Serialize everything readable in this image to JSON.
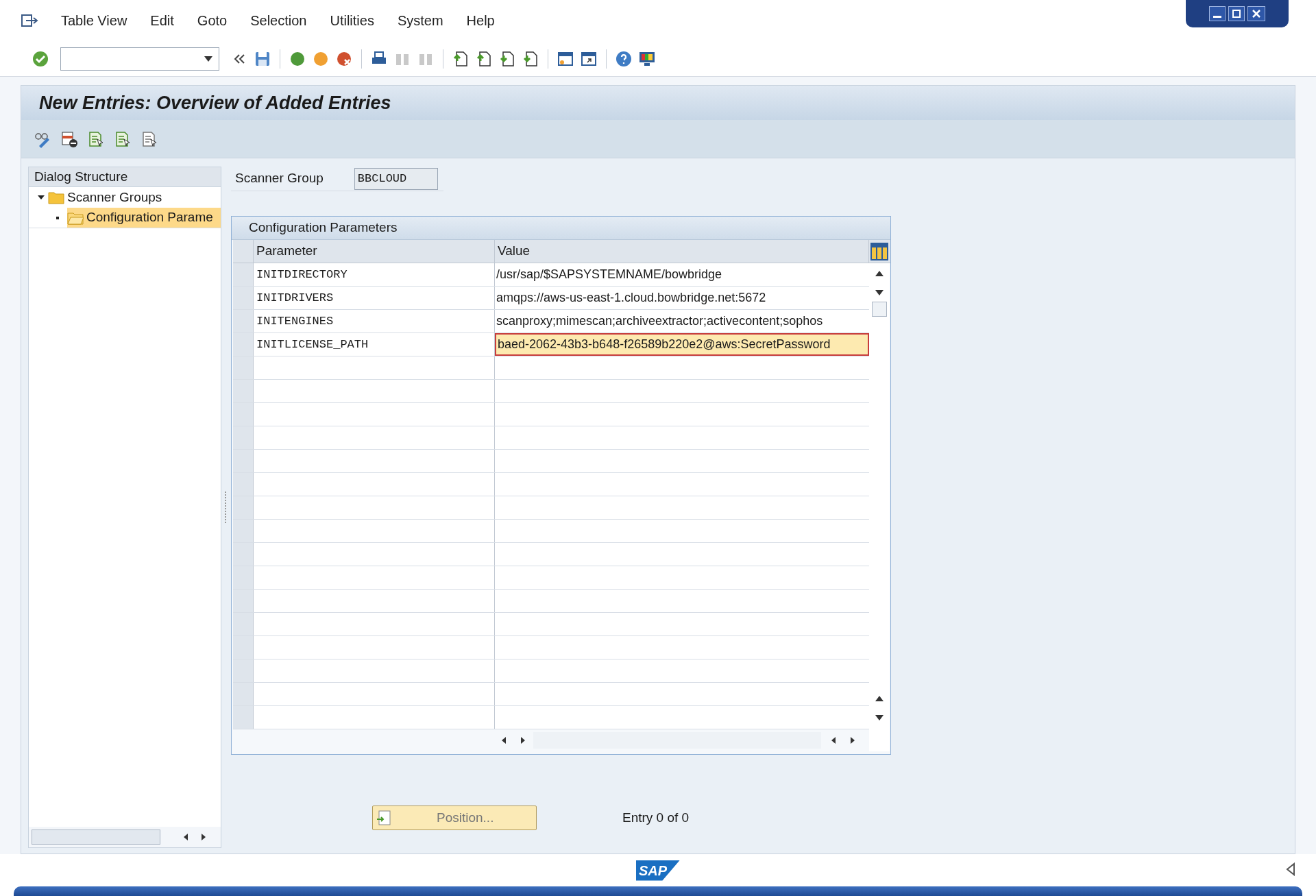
{
  "menu": [
    "Table View",
    "Edit",
    "Goto",
    "Selection",
    "Utilities",
    "System",
    "Help"
  ],
  "title": "New Entries: Overview of Added Entries",
  "dialog_structure": {
    "title": "Dialog Structure",
    "items": [
      {
        "label": "Scanner Groups",
        "expanded": true,
        "selected": false,
        "children": [
          {
            "label": "Configuration Parame",
            "selected": true
          }
        ]
      }
    ]
  },
  "scanner_group": {
    "label": "Scanner Group",
    "value": "BBCLOUD"
  },
  "table": {
    "title": "Configuration Parameters",
    "columns": [
      "Parameter",
      "Value"
    ],
    "rows": [
      {
        "parameter": "INITDIRECTORY",
        "value": "/usr/sap/$SAPSYSTEMNAME/bowbridge",
        "editing": false
      },
      {
        "parameter": "INITDRIVERS",
        "value": "amqps://aws-us-east-1.cloud.bowbridge.net:5672",
        "editing": false
      },
      {
        "parameter": "INITENGINES",
        "value": "scanproxy;mimescan;archiveextractor;activecontent;sophos",
        "editing": false
      },
      {
        "parameter": "INITLICENSE_PATH",
        "value": "baed-2062-43b3-b648-f26589b220e2@aws:SecretPassword",
        "editing": true
      }
    ]
  },
  "position_button": "Position...",
  "entry_info": "Entry 0 of 0",
  "logo_text": "SAP"
}
